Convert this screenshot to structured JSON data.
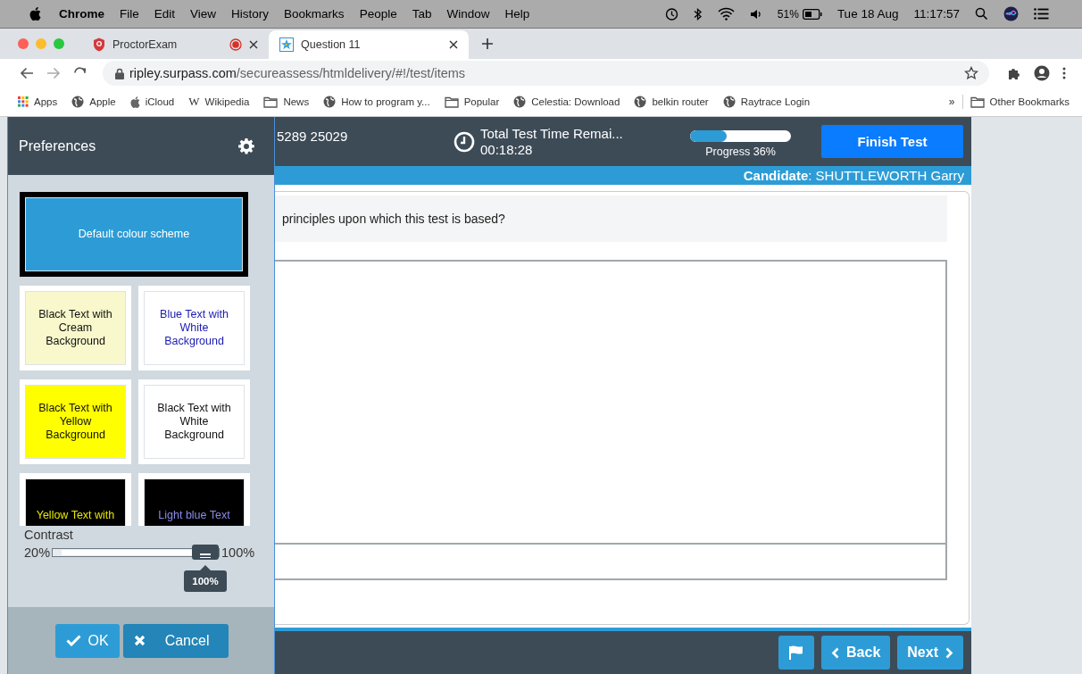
{
  "menu_bar": {
    "app": "Chrome",
    "items": [
      "File",
      "Edit",
      "View",
      "History",
      "Bookmarks",
      "People",
      "Tab",
      "Window",
      "Help"
    ],
    "battery": "51%",
    "date": "Tue 18 Aug",
    "time": "11:17:57"
  },
  "tabs": [
    {
      "title": "ProctorExam",
      "selected": false,
      "recording": true
    },
    {
      "title": "Question 11",
      "selected": true,
      "recording": false
    }
  ],
  "address": {
    "host": "ripley.surpass.com",
    "path": "/secureassess/htmldelivery/#!/test/items"
  },
  "bookmarks": [
    {
      "kind": "apps",
      "label": "Apps"
    },
    {
      "kind": "globe",
      "label": "Apple"
    },
    {
      "kind": "apple",
      "label": "iCloud"
    },
    {
      "kind": "wiki",
      "glyph": "W",
      "label": "Wikipedia"
    },
    {
      "kind": "folder",
      "label": "News"
    },
    {
      "kind": "globe",
      "label": "How to program y..."
    },
    {
      "kind": "folder",
      "label": "Popular"
    },
    {
      "kind": "globe",
      "label": "Celestia: Download"
    },
    {
      "kind": "globe",
      "label": "belkin router"
    },
    {
      "kind": "globe",
      "label": "Raytrace Login"
    }
  ],
  "bookmarks_more": "»",
  "other_bookmarks": "Other Bookmarks",
  "exam": {
    "id": "5289 25029",
    "timer_label": "Total Test Time Remai...",
    "timer_value": "00:18:28",
    "progress": {
      "level": 0.36,
      "label": "Progress 36%"
    },
    "finish_button": "Finish Test",
    "candidate": "**Candidate**: SHUTTLEWORTH Garry",
    "question": "principles upon which this test is based?",
    "back_button": "Back",
    "next_button": "Next"
  },
  "preferences": {
    "title": "Preferences",
    "schemes": [
      {
        "kind": "default",
        "label": "Default colour scheme",
        "selected": true
      },
      {
        "kind": "cream",
        "label": "Black Text with Cream Background",
        "selected": false
      },
      {
        "kind": "bluewhite",
        "label": "Blue Text with White Background",
        "selected": false
      },
      {
        "kind": "yellow",
        "label": "Black Text with Yellow Background",
        "selected": false
      },
      {
        "kind": "white",
        "label": "Black Text with White Background",
        "selected": false
      },
      {
        "kind": "yellowblack",
        "label": "Yellow Text with",
        "selected": false
      },
      {
        "kind": "lightblueblack",
        "label": "Light blue Text",
        "selected": false
      }
    ],
    "contrast": {
      "label": "Contrast",
      "min": "20%",
      "max": "100%",
      "level": 1,
      "reading": "100%"
    },
    "ok_button": "OK",
    "cancel_button": "Cancel"
  }
}
